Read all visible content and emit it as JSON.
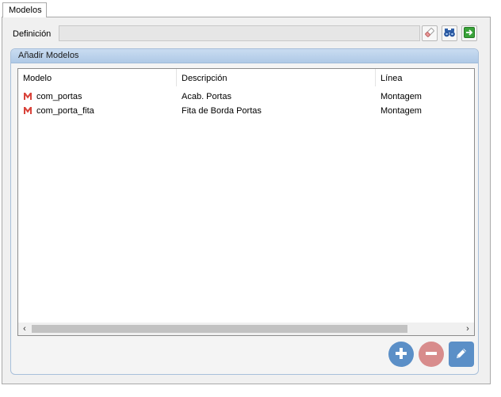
{
  "tab": {
    "label": "Modelos"
  },
  "definition": {
    "label": "Definición",
    "value": ""
  },
  "group": {
    "title": "Añadir Modelos"
  },
  "grid": {
    "columns": [
      "Modelo",
      "Descripción",
      "Línea"
    ],
    "rows": [
      {
        "modelo": "com_portas",
        "descripcion": "Acab. Portas",
        "linea": "Montagem"
      },
      {
        "modelo": "com_porta_fita",
        "descripcion": "Fita de Borda Portas",
        "linea": "Montagem"
      }
    ]
  },
  "colors": {
    "add": "#5b8fc7",
    "remove": "#d88c8c",
    "edit": "#5b8fc7",
    "header_accent": "#c9dcf1",
    "model_icon": "#d9433a"
  },
  "icons": {
    "clear": "eraser-icon",
    "search": "binoculars-icon",
    "go": "green-arrow-icon",
    "add": "plus-icon",
    "remove": "minus-icon",
    "edit": "pencil-icon",
    "model": "model-icon"
  }
}
